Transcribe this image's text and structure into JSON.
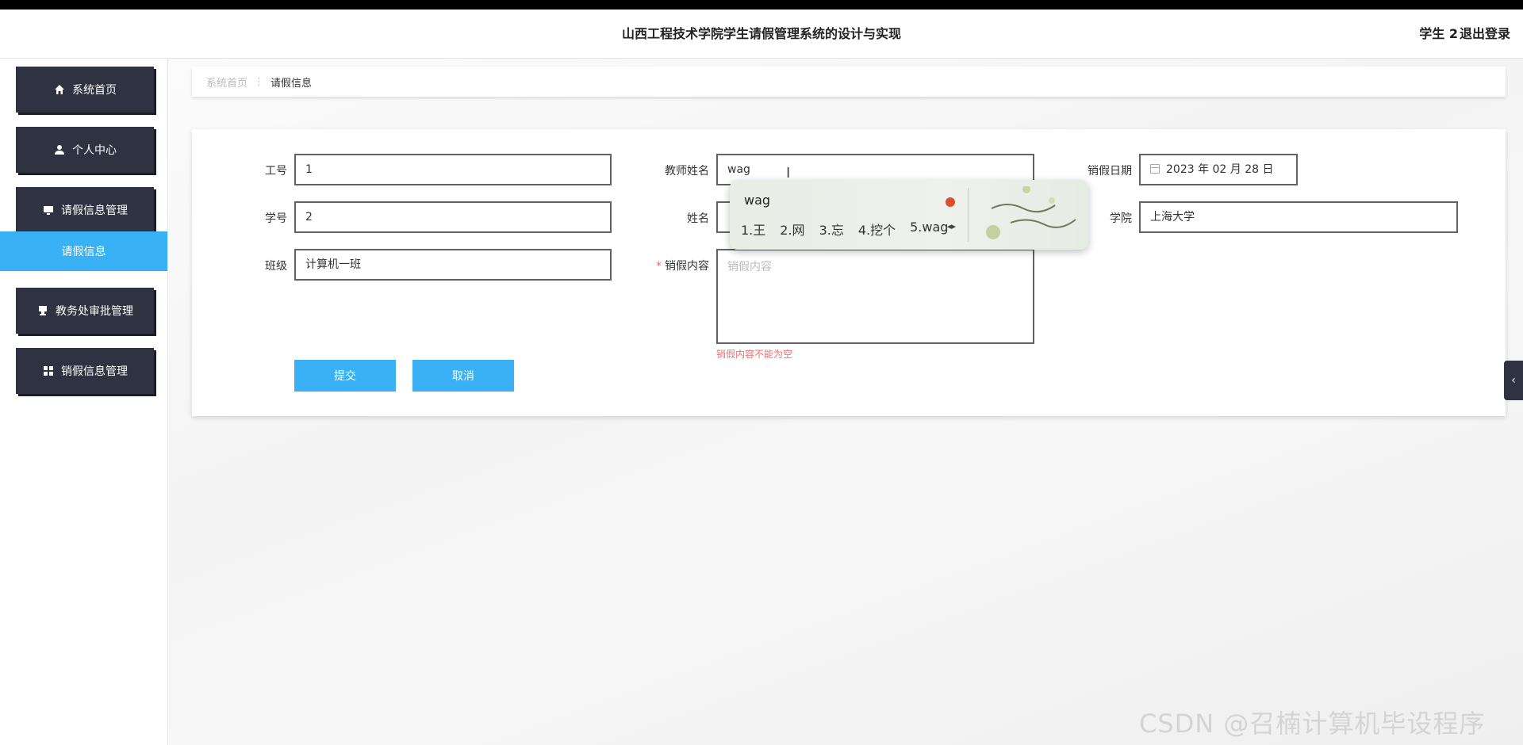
{
  "header": {
    "title": "山西工程技术学院学生请假管理系统的设计与实现",
    "user": "学生 2",
    "logout": "退出登录"
  },
  "sidebar": {
    "items": [
      {
        "label": "系统首页",
        "icon": "home-icon"
      },
      {
        "label": "个人中心",
        "icon": "user-icon"
      },
      {
        "label": "请假信息管理",
        "icon": "monitor-icon"
      },
      {
        "label": "教务处审批管理",
        "icon": "stamp-icon"
      },
      {
        "label": "销假信息管理",
        "icon": "grid-icon"
      }
    ],
    "sub_active": "请假信息"
  },
  "breadcrumb": {
    "home": "系统首页",
    "current": "请假信息"
  },
  "form": {
    "gonghao_label": "工号",
    "gonghao_value": "1",
    "teacher_label": "教师姓名",
    "teacher_value": "wag",
    "date_label": "销假日期",
    "date_value": "2023 年 02 月 28 日",
    "xuehao_label": "学号",
    "xuehao_value": "2",
    "name_label": "姓名",
    "college_label": "学院",
    "college_value": "上海大学",
    "class_label": "班级",
    "class_value": "计算机一班",
    "content_label": "销假内容",
    "content_placeholder": "销假内容",
    "content_error": "销假内容不能为空",
    "submit": "提交",
    "cancel": "取消"
  },
  "ime": {
    "composition": "wag",
    "candidates": [
      "1.王",
      "2.网",
      "3.忘",
      "4.挖个",
      "5.wag"
    ]
  },
  "collapse_icon": "‹",
  "watermark": "CSDN @召楠计算机毕设程序"
}
